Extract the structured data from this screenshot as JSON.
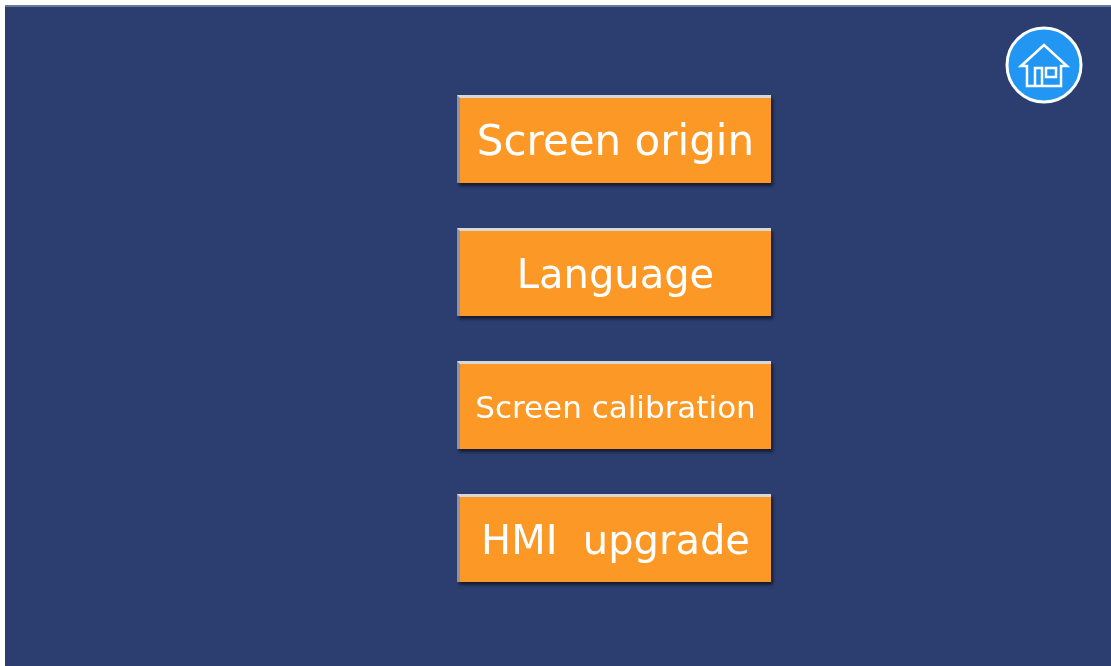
{
  "buttons": [
    {
      "label": "Screen origin"
    },
    {
      "label": "Language"
    },
    {
      "label": "Screen calibration"
    },
    {
      "label": "HMI  upgrade"
    }
  ]
}
